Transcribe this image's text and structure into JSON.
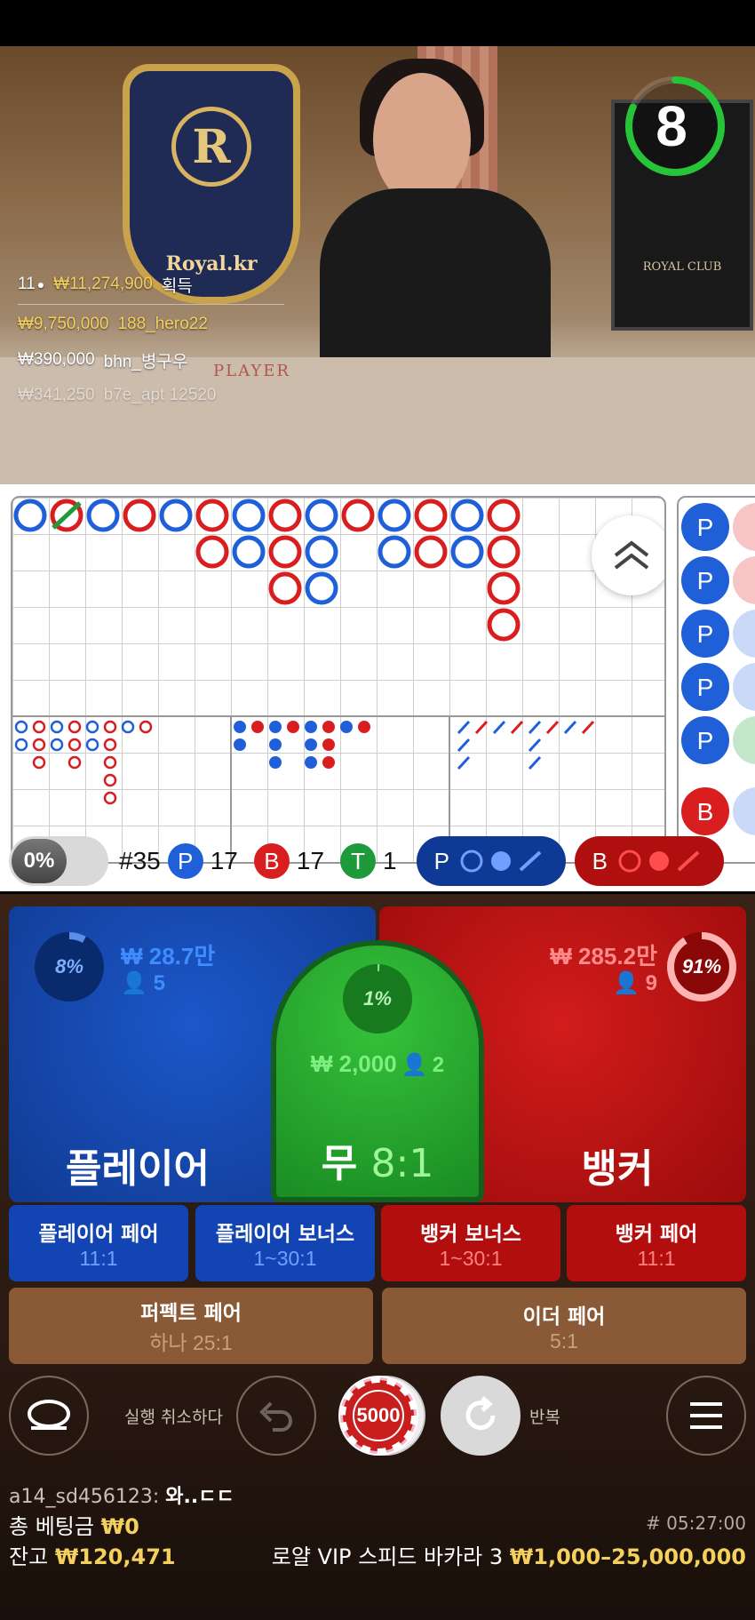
{
  "video": {
    "logo_letter": "R",
    "logo_brand": "Royal.kr",
    "club_sign": "ROYAL CLUB",
    "table_label": "PLAYER",
    "timer": "8",
    "winners_summary": {
      "count": "11",
      "amount": "₩11,274,900",
      "suffix": "획득"
    },
    "winners": [
      {
        "amount": "₩9,750,000",
        "user": "188_hero22",
        "tone": "gold"
      },
      {
        "amount": "₩390,000",
        "user": "bhn_병구우",
        "tone": "white"
      },
      {
        "amount": "₩341,250",
        "user": "b7e_apt 12520",
        "tone": "faded"
      }
    ]
  },
  "roadmap": {
    "stats": {
      "percent_toggle": "0%",
      "round": "#35",
      "player_letter": "P",
      "player_count": "17",
      "banker_letter": "B",
      "banker_count": "17",
      "tie_letter": "T",
      "tie_count": "1"
    },
    "predict": {
      "player_letter": "P",
      "banker_letter": "B"
    },
    "side_letters": [
      "P",
      "P",
      "P",
      "P",
      "P",
      "B"
    ]
  },
  "betting": {
    "player": {
      "title": "플레이어",
      "percent": "8%",
      "amount": "₩ 28.7만",
      "count": "5",
      "ratio": 0.08
    },
    "tie": {
      "title": "무",
      "odds": "8:1",
      "percent": "1%",
      "amount": "₩ 2,000",
      "count": "2",
      "ratio": 0.01
    },
    "banker": {
      "title": "뱅커",
      "percent": "91%",
      "amount": "₩ 285.2만",
      "count": "9",
      "ratio": 0.91
    },
    "side_bets": [
      {
        "name": "플레이어 페어",
        "odds": "11:1"
      },
      {
        "name": "플레이어 보너스",
        "odds": "1~30:1"
      },
      {
        "name": "뱅커 보너스",
        "odds": "1~30:1"
      },
      {
        "name": "뱅커 페어",
        "odds": "11:1"
      }
    ],
    "perfect_pair": {
      "name": "퍼펙트 페어",
      "odds": "하나 25:1"
    },
    "either_pair": {
      "name": "이더 페어",
      "odds": "5:1"
    }
  },
  "controls": {
    "undo_label": "실행 취소하다",
    "chip_value": "5000",
    "repeat_label": "반복"
  },
  "footer": {
    "chat_user": "a14_sd456123:",
    "chat_msg": "와..ㄷㄷ",
    "total_bet_label": "총 베팅금",
    "total_bet_value": "₩0",
    "balance_label": "잔고",
    "balance_value": "₩120,471",
    "round_id": "# 05:27:00",
    "table_name": "로얄 VIP 스피드 바카라 3",
    "limits": "₩1,000–25,000,000"
  },
  "colors": {
    "player": "#1f5fd8",
    "banker": "#d81e1e",
    "tie": "#1f9a3a",
    "gold": "#f4d05c"
  }
}
